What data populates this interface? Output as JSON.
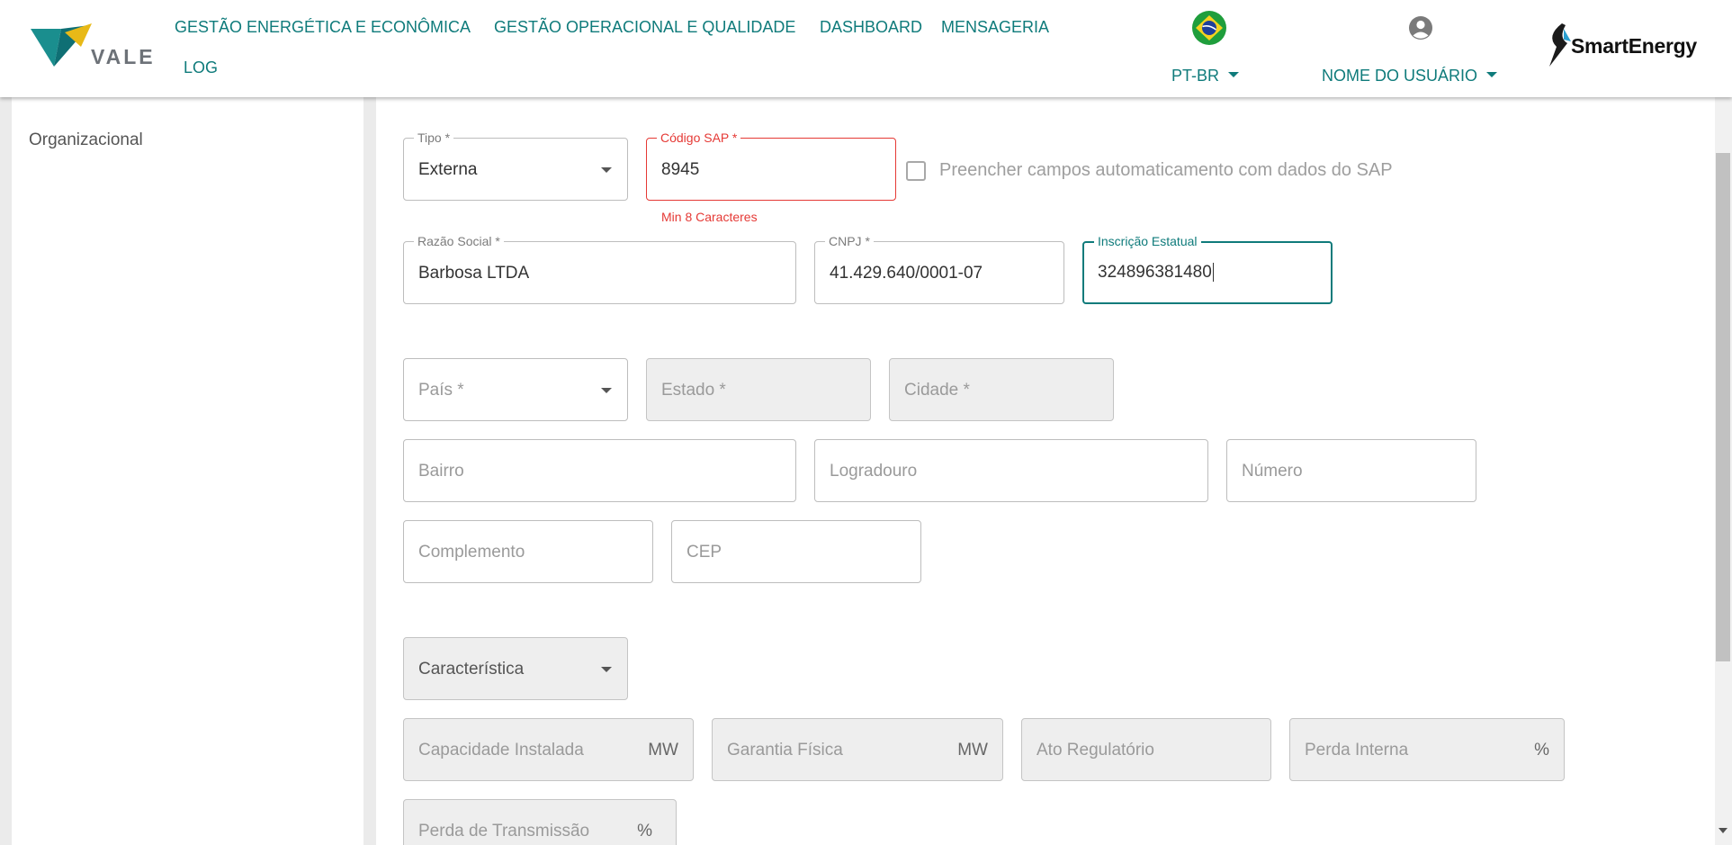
{
  "header": {
    "logo_text": "VALE",
    "nav": [
      "GESTÃO ENERGÉTICA E ECONÔMICA",
      "GESTÃO OPERACIONAL E QUALIDADE",
      "DASHBOARD",
      "MENSAGERIA",
      "LOG"
    ],
    "language": "PT-BR",
    "user": "NOME DO USUÁRIO",
    "brand": "SmartEnergy"
  },
  "sidebar": {
    "items": [
      "Organizacional"
    ]
  },
  "form": {
    "tipo": {
      "label": "Tipo *",
      "value": "Externa"
    },
    "codigo_sap": {
      "label": "Código SAP *",
      "value": "8945",
      "error": "Min 8 Caracteres"
    },
    "preencher_sap": {
      "label": "Preencher campos automaticamento com dados do SAP",
      "checked": false
    },
    "razao_social": {
      "label": "Razão Social *",
      "value": "Barbosa LTDA"
    },
    "cnpj": {
      "label": "CNPJ *",
      "value": "41.429.640/0001-07"
    },
    "inscricao_estadual": {
      "label": "Inscrição Estatual",
      "value": "324896381480"
    },
    "pais": {
      "placeholder": "País *"
    },
    "estado": {
      "placeholder": "Estado *"
    },
    "cidade": {
      "placeholder": "Cidade *"
    },
    "bairro": {
      "placeholder": "Bairro"
    },
    "logradouro": {
      "placeholder": "Logradouro"
    },
    "numero": {
      "placeholder": "Número"
    },
    "complemento": {
      "placeholder": "Complemento"
    },
    "cep": {
      "placeholder": "CEP"
    },
    "caracteristica": {
      "placeholder": "Característica"
    },
    "capacidade_instalada": {
      "placeholder": "Capacidade Instalada",
      "unit": "MW"
    },
    "garantia_fisica": {
      "placeholder": "Garantia Física",
      "unit": "MW"
    },
    "ato_regulatorio": {
      "placeholder": "Ato Regulatório"
    },
    "perda_interna": {
      "placeholder": "Perda Interna",
      "unit": "%"
    },
    "perda_transmissao": {
      "placeholder": "Perda de Transmissão",
      "unit": "%"
    }
  },
  "colors": {
    "accent": "#0f7b7b",
    "error": "#e53935",
    "disabled_bg": "#eeeeee"
  }
}
